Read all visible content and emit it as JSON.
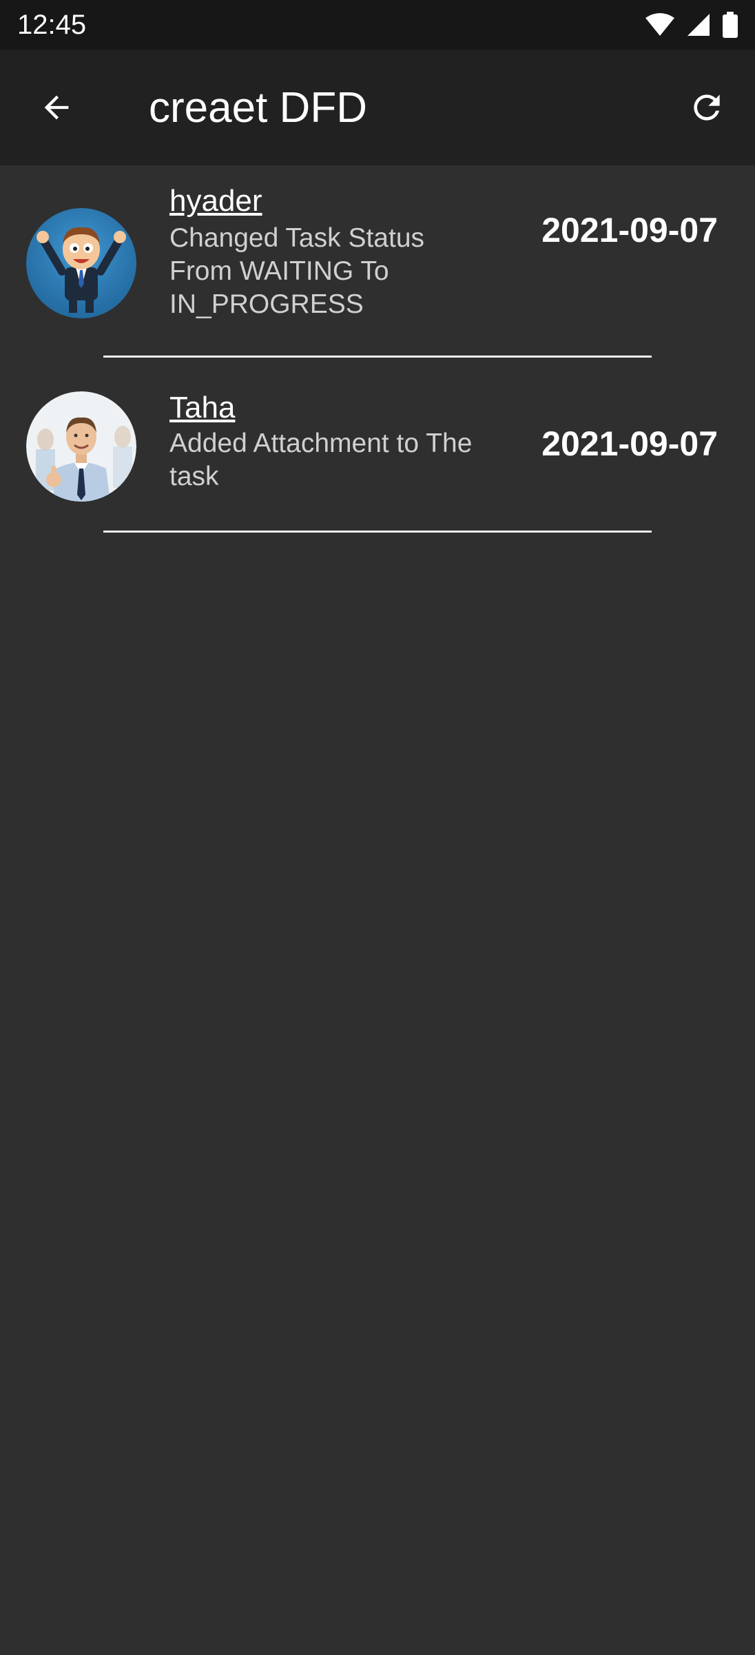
{
  "status_bar": {
    "time": "12:45",
    "icons": [
      "wifi-icon",
      "signal-icon",
      "battery-icon"
    ]
  },
  "app_bar": {
    "title": "creaet DFD",
    "back_icon": "arrow-back-icon",
    "refresh_icon": "refresh-icon"
  },
  "activities": [
    {
      "user": "hyader",
      "description": "Changed Task Status From WAITING To IN_PROGRESS",
      "date": "2021-09-07",
      "avatar": "cartoon-businessman-avatar"
    },
    {
      "user": "Taha",
      "description": "Added Attachment to The task",
      "date": "2021-09-07",
      "avatar": "businessman-photo-avatar"
    }
  ],
  "colors": {
    "background": "#2f2f2f",
    "app_bar": "#212121",
    "status_bar": "#171717",
    "text_primary": "#ffffff",
    "text_secondary": "#d0d0d0"
  }
}
